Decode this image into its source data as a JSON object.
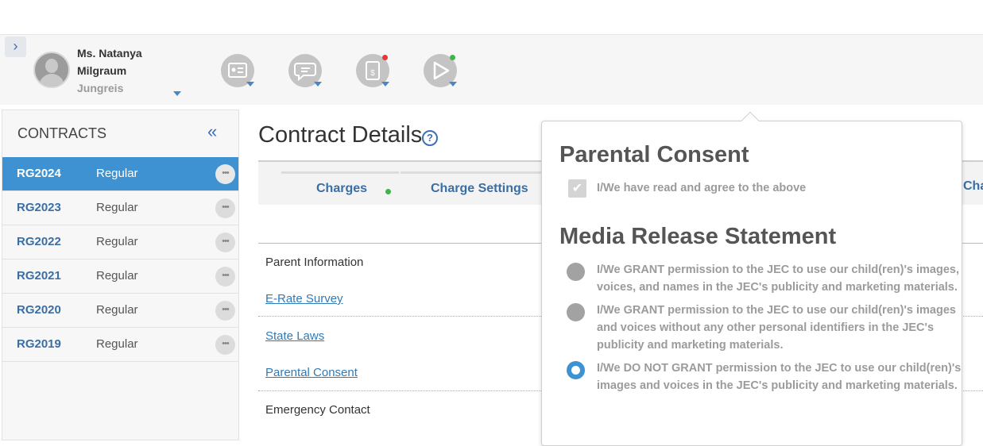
{
  "user": {
    "name_line1": "Ms. Natanya",
    "name_line2": "Milgraum",
    "name_line3": "Jungreis"
  },
  "header_icons": [
    {
      "name": "id-card-icon"
    },
    {
      "name": "chat-icon"
    },
    {
      "name": "billing-icon",
      "dot_color": "#e53935"
    },
    {
      "name": "flag-icon",
      "dot_color": "#3db54a"
    }
  ],
  "sidebar": {
    "title": "CONTRACTS",
    "collapse_glyph": "«",
    "rows": [
      {
        "code": "RG2024",
        "type": "Regular"
      },
      {
        "code": "RG2023",
        "type": "Regular"
      },
      {
        "code": "RG2022",
        "type": "Regular"
      },
      {
        "code": "RG2021",
        "type": "Regular"
      },
      {
        "code": "RG2020",
        "type": "Regular"
      },
      {
        "code": "RG2019",
        "type": "Regular"
      }
    ],
    "more_glyph": "•••"
  },
  "main": {
    "title": "Contract Details",
    "help_glyph": "?",
    "tabs": [
      "Charges",
      "Charge Settings",
      "Cha"
    ],
    "items": {
      "parent_info": "Parent Information",
      "erate": "E-Rate Survey",
      "state_laws": "State Laws",
      "parental_consent": "Parental Consent",
      "emergency": "Emergency Contact"
    }
  },
  "popup": {
    "consent_title": "Parental Consent",
    "consent_check_glyph": "✔",
    "consent_text": "I/We have read and agree to the above",
    "media_title": "Media Release Statement",
    "options": [
      {
        "line1": "I/We GRANT permission to the JEC to use our child(ren)'s images,",
        "line2": "voices, and names in the JEC's publicity and marketing materials."
      },
      {
        "line1": "I/We GRANT permission to the JEC to use our child(ren)'s images",
        "line2": "and voices without any other personal identifiers in the JEC's",
        "line3": "publicity and marketing materials."
      },
      {
        "line1": "I/We DO NOT GRANT permission to the JEC to use our child(ren)'s",
        "line2": "images and voices in the JEC's publicity and marketing materials."
      }
    ]
  },
  "colors": {
    "accent": "#3f92d2",
    "link": "#2f7ab8",
    "status_green": "#3db54a",
    "status_red": "#e53935"
  }
}
